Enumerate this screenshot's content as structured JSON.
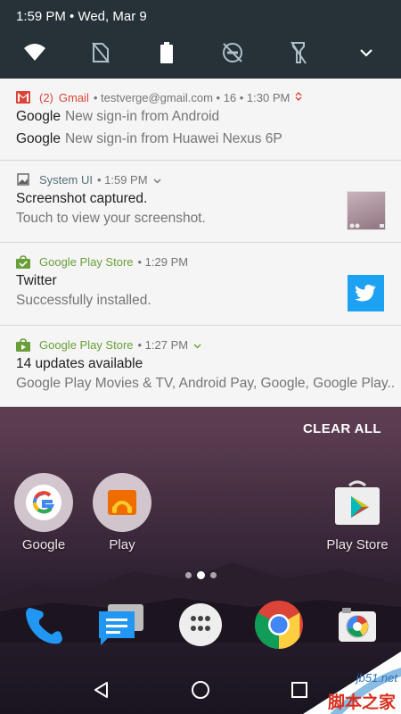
{
  "status": {
    "time_date": "1:59 PM • Wed, Mar 9"
  },
  "quick_settings": {
    "icons": [
      "wifi-icon",
      "no-sim-icon",
      "battery-icon",
      "dnd-off-icon",
      "flashlight-off-icon",
      "expand-chevron-icon"
    ]
  },
  "notifications": {
    "gmail": {
      "app_name": "Gmail",
      "count": "(2)",
      "meta": "• testverge@gmail.com • 16 • 1:30 PM",
      "lines": [
        {
          "sender": "Google",
          "subject": "New sign-in from Android"
        },
        {
          "sender": "Google",
          "subject": "New sign-in from Huawei Nexus 6P"
        }
      ],
      "accent": "#db4437"
    },
    "system_ui": {
      "app_name": "System UI",
      "meta": "• 1:59 PM",
      "title": "Screenshot captured.",
      "text": "Touch to view your screenshot."
    },
    "play_store_1": {
      "app_name": "Google Play Store",
      "meta": "• 1:29 PM",
      "title": "Twitter",
      "text": "Successfully installed.",
      "accent": "#689f38"
    },
    "play_store_2": {
      "app_name": "Google Play Store",
      "meta": "• 1:27 PM",
      "title": "14 updates available",
      "text": "Google Play Movies & TV, Android Pay, Google, Google Play..",
      "accent": "#689f38"
    }
  },
  "clear_all_label": "CLEAR ALL",
  "home": {
    "icons": [
      {
        "label": "Google"
      },
      {
        "label": "Play"
      },
      {
        "label": "Play Store"
      }
    ]
  },
  "watermark": {
    "site": "jb51.net",
    "name": "脚本之家"
  }
}
